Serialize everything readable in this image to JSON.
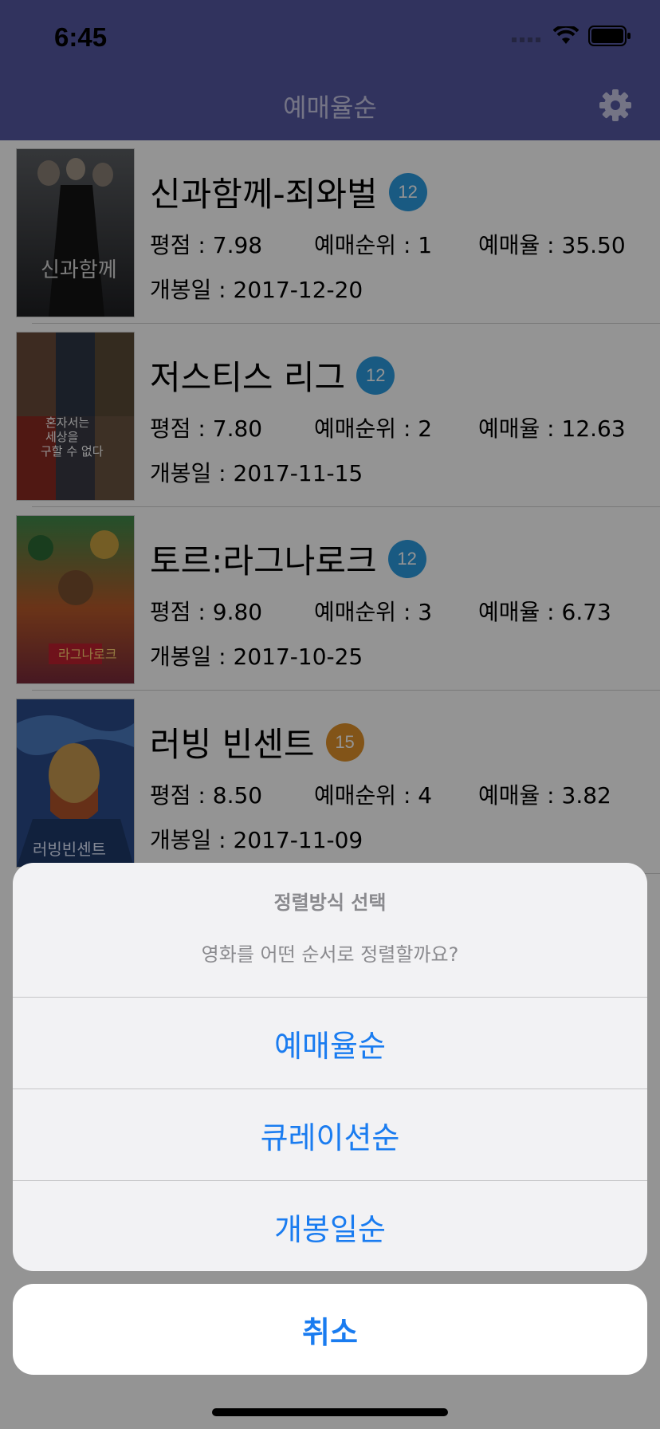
{
  "status": {
    "time": "6:45"
  },
  "nav": {
    "title": "예매율순",
    "settings_icon": "gear-icon"
  },
  "movies": [
    {
      "title": "신과함께-죄와벌",
      "grade": "12",
      "grade_color": "#2b9be0",
      "rating": "평점 : 7.98",
      "rank": "예매순위 : 1",
      "rate": "예매율 : 35.50",
      "release": "개봉일 : 2017-12-20"
    },
    {
      "title": "저스티스 리그",
      "grade": "12",
      "grade_color": "#2b9be0",
      "rating": "평점 : 7.80",
      "rank": "예매순위 : 2",
      "rate": "예매율 : 12.63",
      "release": "개봉일 : 2017-11-15"
    },
    {
      "title": "토르:라그나로크",
      "grade": "12",
      "grade_color": "#2b9be0",
      "rating": "평점 : 9.80",
      "rank": "예매순위 : 3",
      "rate": "예매율 : 6.73",
      "release": "개봉일 : 2017-10-25"
    },
    {
      "title": "러빙 빈센트",
      "grade": "15",
      "grade_color": "#e0922a",
      "rating": "평점 : 8.50",
      "rank": "예매순위 : 4",
      "rate": "예매율 : 3.82",
      "release": "개봉일 : 2017-11-09"
    }
  ],
  "action_sheet": {
    "title": "정렬방식 선택",
    "message": "영화를 어떤 순서로 정렬할까요?",
    "actions": [
      "예매율순",
      "큐레이션순",
      "개봉일순"
    ],
    "cancel": "취소"
  },
  "colors": {
    "nav": "#5558a2",
    "accent": "#1a7cf0"
  }
}
